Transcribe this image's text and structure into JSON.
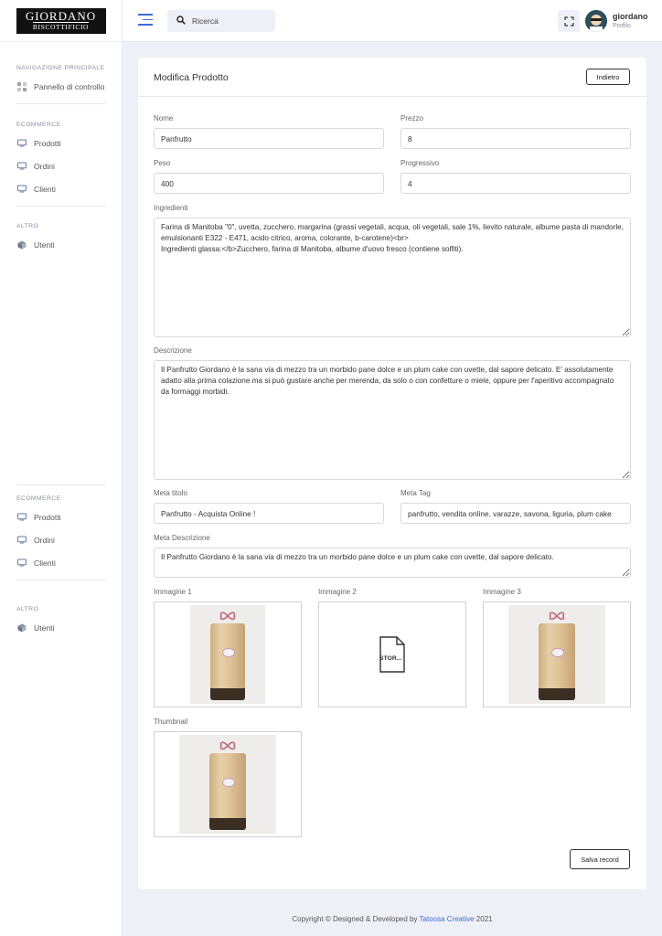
{
  "logo": {
    "line1": "GIORDANO",
    "line2": "BISCOTTIFICIO"
  },
  "sidebar": {
    "sections": [
      {
        "title": "NAVIGAZIONE PRINCIPALE",
        "items": [
          {
            "label": "Pannello di controllo",
            "icon": "dashboard-icon"
          }
        ]
      },
      {
        "title": "ECOMMERCE",
        "items": [
          {
            "label": "Prodotti",
            "icon": "monitor-icon"
          },
          {
            "label": "Ordini",
            "icon": "monitor-icon"
          },
          {
            "label": "Clienti",
            "icon": "monitor-icon"
          }
        ]
      },
      {
        "title": "ALTRO",
        "items": [
          {
            "label": "Utenti",
            "icon": "cube-icon"
          }
        ]
      },
      {
        "title": "ECOMMERCE",
        "items": [
          {
            "label": "Prodotti",
            "icon": "monitor-icon"
          },
          {
            "label": "Ordini",
            "icon": "monitor-icon"
          },
          {
            "label": "Clienti",
            "icon": "monitor-icon"
          }
        ]
      },
      {
        "title": "ALTRO",
        "items": [
          {
            "label": "Utenti",
            "icon": "cube-icon"
          }
        ]
      }
    ]
  },
  "topbar": {
    "search_placeholder": "Ricerca",
    "user_name": "giordano",
    "user_role": "Profilo"
  },
  "card": {
    "title": "Modifica Prodotto",
    "back_label": "Indietro",
    "save_label": "Salva record"
  },
  "form": {
    "nome": {
      "label": "Nome",
      "value": "Panfrutto"
    },
    "prezzo": {
      "label": "Prezzo",
      "value": "8"
    },
    "peso": {
      "label": "Peso",
      "value": "400"
    },
    "progressivo": {
      "label": "Progressivo",
      "value": "4"
    },
    "ingredienti": {
      "label": "Ingredienti",
      "value": "Farina di Manitoba \"0\", uvetta, zucchero, margarina (grassi vegetali, acqua, oli vegetali, sale 1%, lievito naturale, albume pasta di mandorle, emulsionanti E322 - E471, acido citrico, aroma, colorante, b-carotene)<br>\nIngredienti glassa:</b>Zucchero, farina di Manitoba, albume d'uovo fresco (contiene solfiti)."
    },
    "descrizione": {
      "label": "Descrizione",
      "value": "Il Panfrutto Giordano è la sana via di mezzo tra un morbido pane dolce e un plum cake con uvette, dal sapore delicato. E' assolutamente adatto alla prima colazione ma si può gustare anche per merenda, da solo o con confetture o miele, oppure per l'aperitivo accompagnato da formaggi morbidi."
    },
    "meta_titolo": {
      "label": "Meta titolo",
      "value": "Panfrutto - Acquista Online !"
    },
    "meta_tag": {
      "label": "Meta Tag",
      "value": "panfrutto, vendita online, varazze, savona, liguria, plum cake"
    },
    "meta_descrizione": {
      "label": "Meta Descrizione",
      "value": "Il Panfrutto Giordano è la sana via di mezzo tra un morbido pane dolce e un plum cake con uvette, dal sapore delicato."
    }
  },
  "images": {
    "img1_label": "Immagine 1",
    "img2_label": "Immagine 2",
    "img2_file_text": "STOR...",
    "img3_label": "Immagine 3",
    "thumb_label": "Thumbnail"
  },
  "footer": {
    "text_before": "Copyright © Designed & Developed by ",
    "brand": "Tatoosa Creative",
    "text_after": " 2021"
  },
  "colors": {
    "accent": "#3b6cd4",
    "background": "#eef0f7"
  }
}
